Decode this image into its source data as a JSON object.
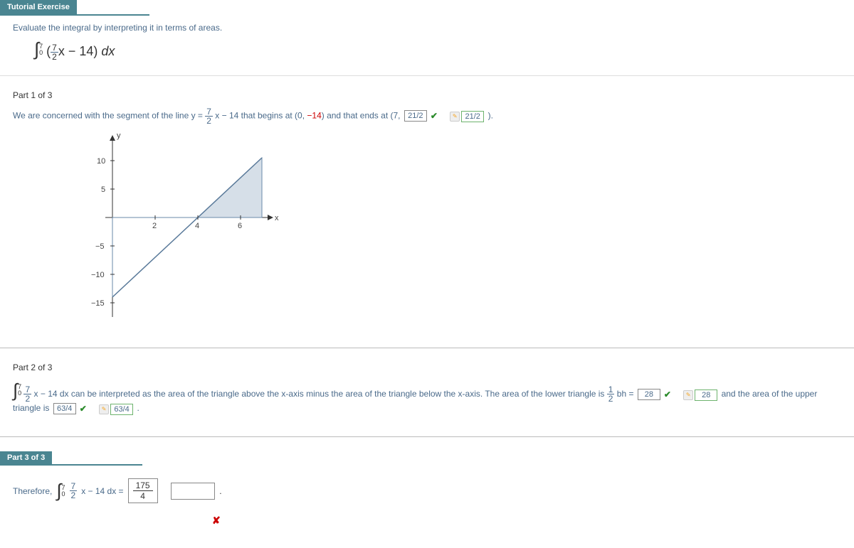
{
  "header": {
    "tab": "Tutorial Exercise"
  },
  "problem": {
    "instructions": "Evaluate the integral by interpreting it in terms of areas.",
    "integral_upper": "7",
    "integral_lower": "0",
    "integrand_frac_top": "7",
    "integrand_frac_bot": "2",
    "integrand_tail": "x − 14",
    "dx": "dx"
  },
  "part1": {
    "label": "Part 1 of 3",
    "text_a": "We are concerned with the segment of the line  y = ",
    "frac_top": "7",
    "frac_bot": "2",
    "text_b": "x − 14  that begins at  (0, ",
    "neg14": "−14",
    "text_c": ")  and that ends at  (7, ",
    "ans1": "21/2",
    "ans2": "21/2",
    "text_d": ").",
    "graph": {
      "ylabel": "y",
      "xlabel": "x",
      "yticks": [
        "10",
        "5",
        "−5",
        "−10",
        "−15"
      ],
      "xticks": [
        "2",
        "4",
        "6"
      ]
    }
  },
  "part2": {
    "label": "Part 2 of 3",
    "int_upper": "7",
    "int_lower": "0",
    "frac_top": "7",
    "frac_bot": "2",
    "text_a": "x − 14 dx  can be interpreted as the area of the triangle above the x-axis minus the area of the triangle below the x-axis. The area of the lower triangle is ",
    "bh_frac_top": "1",
    "bh_frac_bot": "2",
    "bh_text": " bh = ",
    "ans1": "28",
    "ans2": "28",
    "text_b": "  and the area of the upper triangle is ",
    "ans3": "63/4",
    "ans4": "63/4",
    "period": " ."
  },
  "part3": {
    "label": "Part 3 of 3",
    "therefore": "Therefore, ",
    "int_upper": "7",
    "int_lower": "0",
    "frac_top": "7",
    "frac_bot": "2",
    "tail": "x − 14 dx =",
    "ans_top": "175",
    "ans_bot": "4"
  },
  "chart_data": {
    "type": "line",
    "title": "",
    "xlabel": "x",
    "ylabel": "y",
    "xlim": [
      0,
      7.2
    ],
    "ylim": [
      -15,
      12
    ],
    "series": [
      {
        "name": "y = 7/2 x - 14",
        "points": [
          [
            0,
            -14
          ],
          [
            4,
            0
          ],
          [
            7,
            10.5
          ]
        ]
      }
    ],
    "shaded_regions": [
      {
        "name": "lower-triangle",
        "vertices": [
          [
            0,
            0
          ],
          [
            4,
            0
          ],
          [
            0,
            -14
          ]
        ]
      },
      {
        "name": "upper-triangle",
        "vertices": [
          [
            4,
            0
          ],
          [
            7,
            0
          ],
          [
            7,
            10.5
          ]
        ]
      }
    ],
    "xticks": [
      2,
      4,
      6
    ],
    "yticks": [
      -15,
      -10,
      -5,
      5,
      10
    ]
  }
}
